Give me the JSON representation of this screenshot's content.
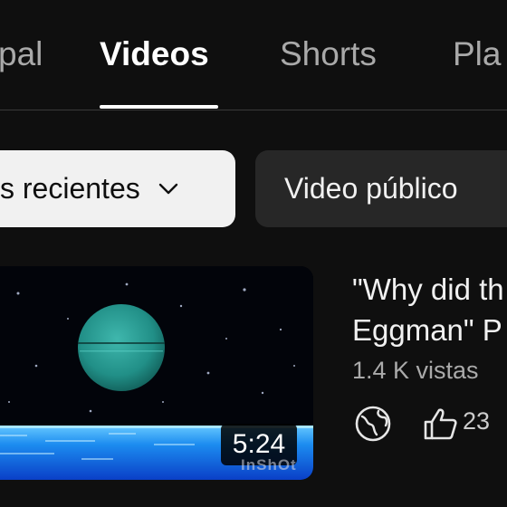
{
  "tabs": [
    {
      "label": "Principal",
      "display": "pal"
    },
    {
      "label": "Videos"
    },
    {
      "label": "Shorts"
    },
    {
      "label": "Playlists",
      "display": "Pla"
    }
  ],
  "active_tab": "Videos",
  "chips": {
    "sort": {
      "label": "Más recientes",
      "display": "s recientes"
    },
    "filter": {
      "label": "Video público"
    }
  },
  "video": {
    "title_line1": "\"Why did th",
    "title_line2": "Eggman\" P",
    "views": "1.4 K vistas",
    "duration": "5:24",
    "likes": "23",
    "visibility_icon": "globe-icon",
    "watermark": "InShOt"
  },
  "colors": {
    "background": "#0f0f0f",
    "chip_active_bg": "#f1f1f1",
    "chip_bg": "#272727",
    "text_secondary": "#aaaaaa"
  }
}
